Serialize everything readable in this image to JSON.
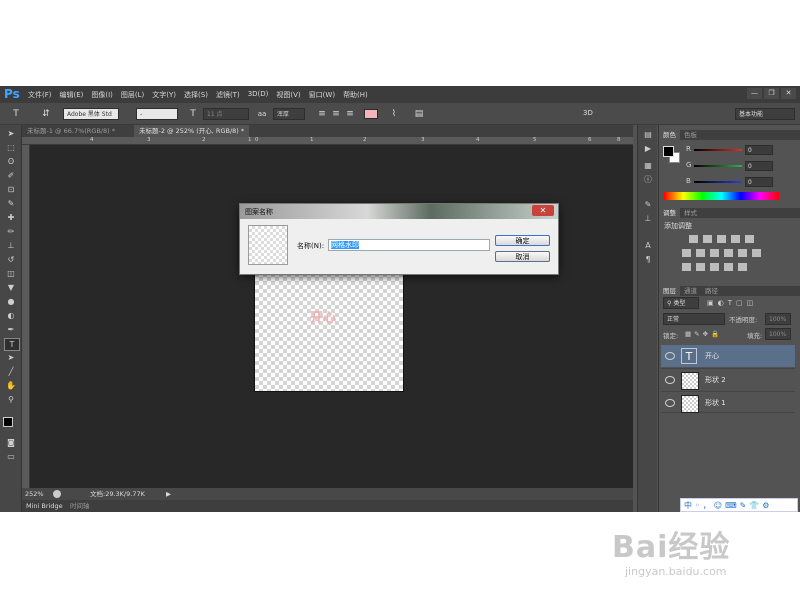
{
  "app": {
    "logo": "Ps",
    "menu": [
      "文件(F)",
      "编辑(E)",
      "图像(I)",
      "图层(L)",
      "文字(Y)",
      "选择(S)",
      "滤镜(T)",
      "3D(D)",
      "视图(V)",
      "窗口(W)",
      "帮助(H)"
    ],
    "window_buttons": [
      "—",
      "❐",
      "✕"
    ]
  },
  "options_bar": {
    "font_family": "Adobe 黑体 Std",
    "font_style": "-",
    "font_size": "11 点",
    "antialias": "浑厚",
    "mode_3d": "3D",
    "workspace": "基本功能",
    "text_color": "#f2b6b8"
  },
  "document_tabs": [
    "未标题-1 @ 66.7%(RGB/8) *",
    "未标题-2 @ 252% (开心, RGB/8) *"
  ],
  "ruler_ticks": [
    "4",
    "3",
    "2",
    "1",
    "0",
    "1",
    "2",
    "3",
    "4",
    "5",
    "6",
    "7",
    "8"
  ],
  "canvas": {
    "text": "开心",
    "text_color": "#f0b0b4"
  },
  "dialog": {
    "title": "图案名称",
    "close_symbol": "✕",
    "name_label": "名称(N):",
    "name_value": "网格水印",
    "ok_label": "确定",
    "cancel_label": "取消"
  },
  "status": {
    "zoom": "252%",
    "doc_info": "文档:29.3K/9.77K"
  },
  "bottom_tabs": [
    "Mini Bridge",
    "时间轴"
  ],
  "panels": {
    "color_tabs": [
      "颜色",
      "色板"
    ],
    "channels": [
      {
        "label": "R",
        "value": "0",
        "color": "#e0302a"
      },
      {
        "label": "G",
        "value": "0",
        "color": "#2fb24a"
      },
      {
        "label": "B",
        "value": "0",
        "color": "#2c3fd6"
      }
    ],
    "adjust_tabs": [
      "调整",
      "样式"
    ],
    "adjust_heading": "添加调整",
    "layers_tabs": [
      "图层",
      "通道",
      "路径"
    ],
    "layer_filter": "类型",
    "blend_mode": "正常",
    "opacity_label": "不透明度:",
    "opacity_value": "100%",
    "lock_label": "锁定:",
    "fill_label": "填充:",
    "fill_value": "100%",
    "layers": [
      {
        "name": "开心",
        "type": "text",
        "selected": true
      },
      {
        "name": "形状 2",
        "type": "shape",
        "selected": false
      },
      {
        "name": "形状 1",
        "type": "shape",
        "selected": false
      }
    ]
  },
  "ime_bar": [
    "中",
    "◦",
    "，",
    "☺",
    "⌨",
    "✎",
    "👕",
    "⚙"
  ],
  "watermark": {
    "logo": "Bai经验",
    "url": "jingyan.baidu.com"
  }
}
